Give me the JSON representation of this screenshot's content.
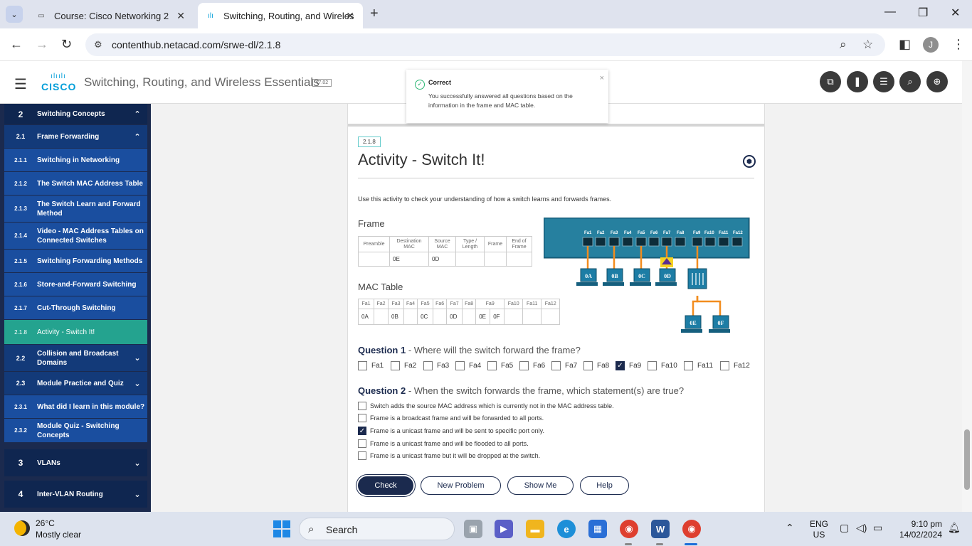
{
  "browser": {
    "tabs": [
      {
        "title": "Course: Cisco Networking 2",
        "active": false
      },
      {
        "title": "Switching, Routing, and Wireles",
        "active": true
      }
    ],
    "url": "contenthub.netacad.com/srwe-dl/2.1.8",
    "profile_initial": "J"
  },
  "header": {
    "logo_text": "CISCO",
    "logo_bars": "ılıılı",
    "course_title": "Switching, Routing, and Wireless Essentials",
    "version": "v7.02"
  },
  "sidebar": {
    "items": [
      {
        "num": "2",
        "label": "Switching Concepts",
        "level": "module",
        "chevron": "up"
      },
      {
        "num": "2.1",
        "label": "Frame Forwarding",
        "level": "sub",
        "chevron": "up"
      },
      {
        "num": "2.1.1",
        "label": "Switching in Networking",
        "level": "leaf"
      },
      {
        "num": "2.1.2",
        "label": "The Switch MAC Address Table",
        "level": "leaf"
      },
      {
        "num": "2.1.3",
        "label": "The Switch Learn and Forward Method",
        "level": "leaf"
      },
      {
        "num": "2.1.4",
        "label": "Video - MAC Address Tables on Connected Switches",
        "level": "leaf"
      },
      {
        "num": "2.1.5",
        "label": "Switching Forwarding Methods",
        "level": "leaf"
      },
      {
        "num": "2.1.6",
        "label": "Store-and-Forward Switching",
        "level": "leaf"
      },
      {
        "num": "2.1.7",
        "label": "Cut-Through Switching",
        "level": "leaf"
      },
      {
        "num": "2.1.8",
        "label": "Activity - Switch It!",
        "level": "leaf",
        "active": true
      },
      {
        "num": "2.2",
        "label": "Collision and Broadcast Domains",
        "level": "sub",
        "chevron": "down"
      },
      {
        "num": "2.3",
        "label": "Module Practice and Quiz",
        "level": "sub",
        "chevron": "down"
      },
      {
        "num": "2.3.1",
        "label": "What did I learn in this module?",
        "level": "leaf"
      },
      {
        "num": "2.3.2",
        "label": "Module Quiz - Switching Concepts",
        "level": "leaf"
      },
      {
        "num": "3",
        "label": "VLANs",
        "level": "module",
        "chevron": "down"
      },
      {
        "num": "4",
        "label": "Inter-VLAN Routing",
        "level": "module",
        "chevron": "down"
      }
    ]
  },
  "toast": {
    "title": "Correct",
    "body": "You successfully answered all questions based on the information in the frame and MAC table."
  },
  "activity": {
    "section": "2.1.8",
    "title": "Activity - Switch It!",
    "intro": "Use this activity to check your understanding of how a switch learns and forwards frames.",
    "frame_label": "Frame",
    "frame_headers": [
      "Preamble",
      "Destination MAC",
      "Source MAC",
      "Type / Length",
      "Frame",
      "End of Frame"
    ],
    "frame_values": [
      "",
      "0E",
      "0D",
      "",
      "",
      ""
    ],
    "mac_label": "MAC Table",
    "mac_headers": [
      "Fa1",
      "Fa2",
      "Fa3",
      "Fa4",
      "Fa5",
      "Fa6",
      "Fa7",
      "Fa8",
      "Fa9",
      "Fa10",
      "Fa11",
      "Fa12"
    ],
    "mac_values": [
      "0A",
      "",
      "0B",
      "",
      "0C",
      "",
      "0D",
      "",
      "0E",
      "0F",
      "",
      "",
      ""
    ],
    "diagram": {
      "ports": [
        "Fa1",
        "Fa2",
        "Fa3",
        "Fa4",
        "Fa5",
        "Fa6",
        "Fa7",
        "Fa8",
        "Fa9",
        "Fa10",
        "Fa11",
        "Fa12"
      ],
      "hosts": [
        "0A",
        "0B",
        "0C",
        "0D",
        "0E",
        "0F"
      ]
    },
    "q1": {
      "label": "Question 1",
      "text": "- Where will the switch forward the frame?",
      "options": [
        {
          "label": "Fa1",
          "checked": false
        },
        {
          "label": "Fa2",
          "checked": false
        },
        {
          "label": "Fa3",
          "checked": false
        },
        {
          "label": "Fa4",
          "checked": false
        },
        {
          "label": "Fa5",
          "checked": false
        },
        {
          "label": "Fa6",
          "checked": false
        },
        {
          "label": "Fa7",
          "checked": false
        },
        {
          "label": "Fa8",
          "checked": false
        },
        {
          "label": "Fa9",
          "checked": true
        },
        {
          "label": "Fa10",
          "checked": false
        },
        {
          "label": "Fa11",
          "checked": false
        },
        {
          "label": "Fa12",
          "checked": false
        }
      ]
    },
    "q2": {
      "label": "Question 2",
      "text": "- When the switch forwards the frame, which statement(s) are true?",
      "options": [
        {
          "label": "Switch adds the source MAC address which is currently not in the MAC address table.",
          "checked": false
        },
        {
          "label": "Frame is a broadcast frame and will be forwarded to all ports.",
          "checked": false
        },
        {
          "label": "Frame is a unicast frame and will be sent to specific port only.",
          "checked": true
        },
        {
          "label": "Frame is a unicast frame and will be flooded to all ports.",
          "checked": false
        },
        {
          "label": "Frame is a unicast frame but it will be dropped at the switch.",
          "checked": false
        }
      ]
    },
    "buttons": {
      "check": "Check",
      "new_problem": "New Problem",
      "show_me": "Show Me",
      "help": "Help"
    }
  },
  "taskbar": {
    "temperature": "26°C",
    "weather": "Mostly clear",
    "search": "Search",
    "lang1": "ENG",
    "lang2": "US",
    "time": "9:10 pm",
    "date": "14/02/2024"
  }
}
